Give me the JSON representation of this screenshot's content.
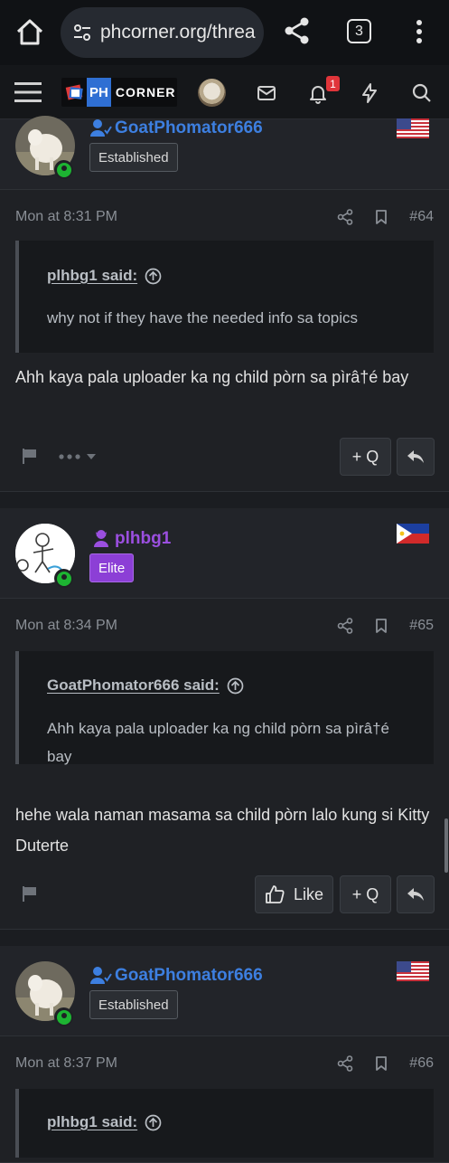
{
  "browser": {
    "url": "phcorner.org/threa",
    "tab_count": "3"
  },
  "header": {
    "logo_ph": "PH",
    "logo_corner": "CORNER",
    "notification_count": "1"
  },
  "posts": [
    {
      "username": "GoatPhomator666",
      "username_color": "#3d7fe0",
      "rank": "Established",
      "flag": "us-flag",
      "time": "Mon at 8:31 PM",
      "number": "#64",
      "quote_author": "plhbg1 said:",
      "quote_text": "why not if they have the needed info sa topics",
      "message": "Ahh kaya pala uploader ka ng child pòrn sa pìrâ†é bay",
      "quote_button": "+ Q"
    },
    {
      "username": "plhbg1",
      "username_color": "#9b4fe0",
      "rank": "Elite",
      "flag": "ph-flag",
      "time": "Mon at 8:34 PM",
      "number": "#65",
      "quote_author": "GoatPhomator666 said:",
      "quote_text": "Ahh kaya pala uploader ka ng child pòrn sa pìrâ†é bay",
      "message": "hehe wala naman masama sa child pòrn lalo kung si Kitty Duterte",
      "like_button": "Like",
      "quote_button": "+ Q"
    },
    {
      "username": "GoatPhomator666",
      "username_color": "#3d7fe0",
      "rank": "Established",
      "flag": "us-flag",
      "time": "Mon at 8:37 PM",
      "number": "#66",
      "quote_author": "plhbg1 said:"
    }
  ]
}
